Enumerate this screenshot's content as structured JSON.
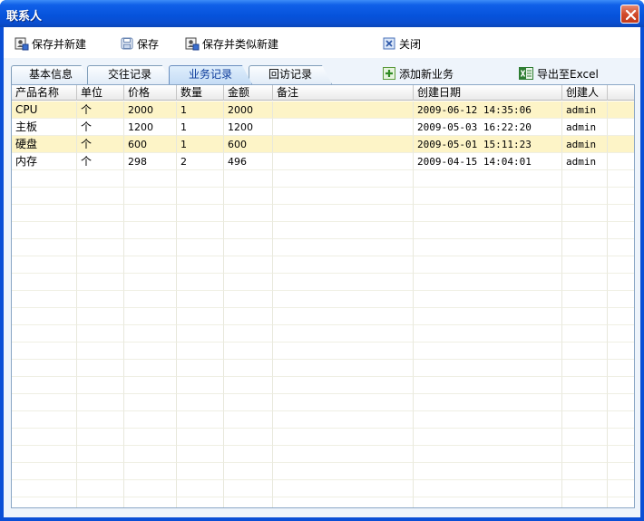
{
  "window": {
    "title": "联系人",
    "close_icon": "close-icon"
  },
  "toolbar": {
    "save_new": "保存并新建",
    "save": "保存",
    "save_similar": "保存并类似新建",
    "close": "关闭"
  },
  "tabs": [
    {
      "label": "基本信息"
    },
    {
      "label": "交往记录"
    },
    {
      "label": "业务记录"
    },
    {
      "label": "回访记录"
    }
  ],
  "tab_actions": {
    "add_business": "添加新业务",
    "export_excel": "导出至Excel"
  },
  "grid": {
    "columns": [
      "产品名称",
      "单位",
      "价格",
      "数量",
      "金额",
      "备注",
      "创建日期",
      "创建人"
    ],
    "rows": [
      [
        "CPU",
        "个",
        "2000",
        "1",
        "2000",
        "",
        "2009-06-12 14:35:06",
        "admin"
      ],
      [
        "主板",
        "个",
        "1200",
        "1",
        "1200",
        "",
        "2009-05-03 16:22:20",
        "admin"
      ],
      [
        "硬盘",
        "个",
        "600",
        "1",
        "600",
        "",
        "2009-05-01 15:11:23",
        "admin"
      ],
      [
        "内存",
        "个",
        "298",
        "2",
        "496",
        "",
        "2009-04-15 14:04:01",
        "admin"
      ]
    ]
  },
  "colors": {
    "titlebar": "#0652db",
    "row_highlight": "#fdf4c7",
    "active_tab_text": "#0b3a9a"
  }
}
